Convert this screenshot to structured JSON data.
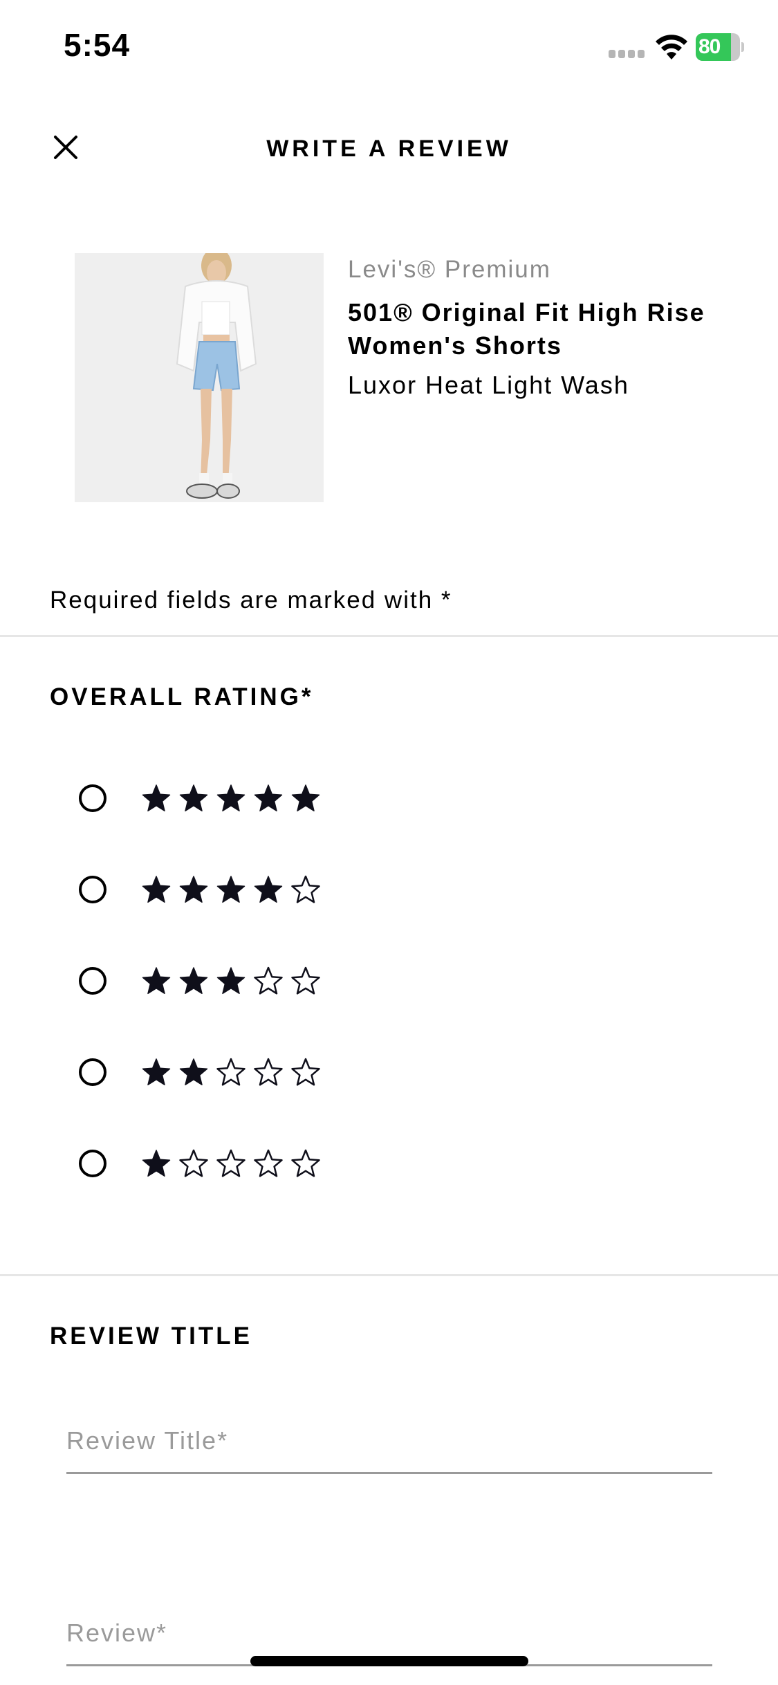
{
  "status_bar": {
    "time": "5:54",
    "battery": "80"
  },
  "header": {
    "title": "WRITE A REVIEW",
    "close_icon": "close-icon"
  },
  "product": {
    "brand": "Levi's® Premium",
    "name": "501® Original Fit High Rise Women's Shorts",
    "color": "Luxor Heat Light Wash"
  },
  "required_note": "Required fields are marked with *",
  "overall_rating": {
    "title": "OVERALL RATING*",
    "options": [
      {
        "stars": 5,
        "selected": false
      },
      {
        "stars": 4,
        "selected": false
      },
      {
        "stars": 3,
        "selected": false
      },
      {
        "stars": 2,
        "selected": false
      },
      {
        "stars": 1,
        "selected": false
      }
    ],
    "max_stars": 5,
    "star_color": "#0f0f1a"
  },
  "review_title": {
    "title": "REVIEW TITLE",
    "title_placeholder": "Review Title*",
    "review_placeholder": "Review*"
  },
  "colors": {
    "battery_green": "#34c759",
    "divider": "#e6e6e6",
    "muted_text": "#8a8a8a"
  }
}
